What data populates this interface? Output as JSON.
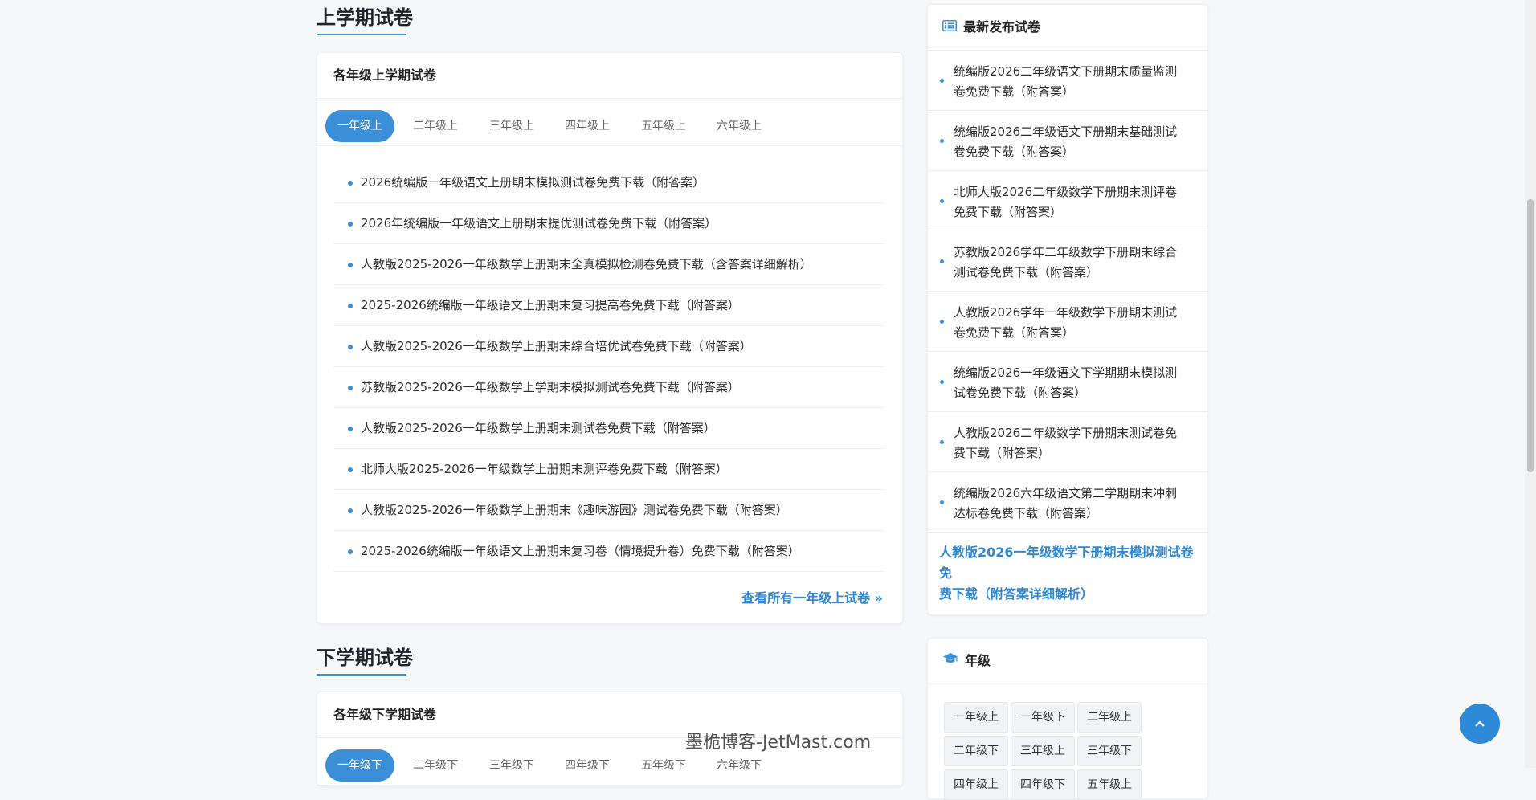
{
  "upper": {
    "section_title": "上学期试卷",
    "card_title": "各年级上学期试卷",
    "tabs": [
      "一年级上",
      "二年级上",
      "三年级上",
      "四年级上",
      "五年级上",
      "六年级上"
    ],
    "items": [
      "2026统编版一年级语文上册期末模拟测试卷免费下载（附答案）",
      "2026年统编版一年级语文上册期末提优测试卷免费下载（附答案）",
      "人教版2025-2026一年级数学上册期末全真模拟检测卷免费下载（含答案详细解析）",
      "2025-2026统编版一年级语文上册期末复习提高卷免费下载（附答案）",
      "人教版2025-2026一年级数学上册期末综合培优试卷免费下载（附答案）",
      "苏教版2025-2026一年级数学上学期末模拟测试卷免费下载（附答案）",
      "人教版2025-2026一年级数学上册期末测试卷免费下载（附答案）",
      "北师大版2025-2026一年级数学上册期末测评卷免费下载（附答案）",
      "人教版2025-2026一年级数学上册期末《趣味游园》测试卷免费下载（附答案）",
      "2025-2026统编版一年级语文上册期末复习卷（情境提升卷）免费下载（附答案）"
    ],
    "more": "查看所有一年级上试卷 »"
  },
  "lower": {
    "section_title": "下学期试卷",
    "card_title": "各年级下学期试卷",
    "tabs": [
      "一年级下",
      "二年级下",
      "三年级下",
      "四年级下",
      "五年级下",
      "六年级下"
    ]
  },
  "latest": {
    "title": "最新发布试卷",
    "items": [
      [
        "统编版2026二年级语文下册期末质量监测",
        "卷免费下载（附答案）"
      ],
      [
        "统编版2026二年级语文下册期末基础测试",
        "卷免费下载（附答案）"
      ],
      [
        "北师大版2026二年级数学下册期末测评卷",
        "免费下载（附答案）"
      ],
      [
        "苏教版2026学年二年级数学下册期末综合",
        "测试卷免费下载（附答案）"
      ],
      [
        "人教版2026学年一年级数学下册期末测试",
        "卷免费下载（附答案）"
      ],
      [
        "统编版2026一年级语文下学期期末模拟测",
        "试卷免费下载（附答案）"
      ],
      [
        "人教版2026二年级数学下册期末测试卷免",
        "费下载（附答案）"
      ],
      [
        "统编版2026六年级语文第二学期期末冲刺",
        "达标卷免费下载（附答案）"
      ]
    ],
    "featured": [
      "人教版2026一年级数学下册期末模拟测试卷免",
      "费下载（附答案详细解析）"
    ]
  },
  "grades": {
    "title": "年级",
    "buttons": [
      "一年级上",
      "一年级下",
      "二年级上",
      "二年级下",
      "三年级上",
      "三年级下",
      "四年级上",
      "四年级下",
      "五年级上"
    ]
  },
  "watermark": "墨桅博客-JetMast.com",
  "back_to_top_icon": "chevron-up-icon",
  "colors": {
    "accent": "#3a8fd8",
    "link": "#2f86d1"
  }
}
